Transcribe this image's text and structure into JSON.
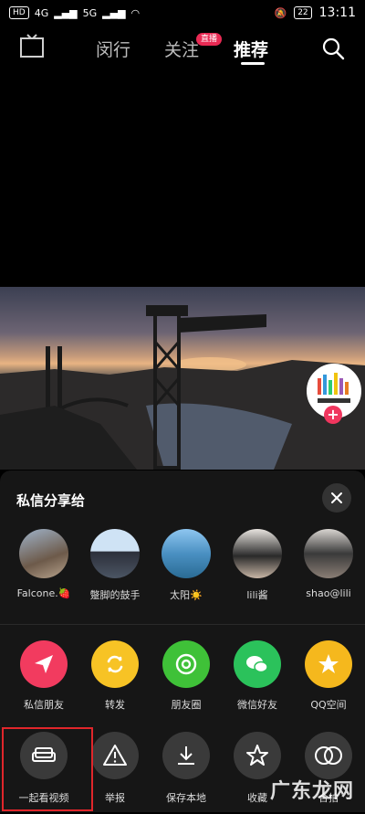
{
  "status_bar": {
    "left_badges": [
      "HD",
      "4G",
      "5G"
    ],
    "battery": "22",
    "time": "13:11"
  },
  "top_nav": {
    "live_icon_label": "直播",
    "tabs": [
      {
        "label": "闵行"
      },
      {
        "label": "关注"
      },
      {
        "label": "推荐"
      }
    ],
    "live_badge": "直播"
  },
  "share_sheet": {
    "title": "私信分享给",
    "friends": [
      {
        "name": "Falcone.🍓"
      },
      {
        "name": "蹩脚的鼓手"
      },
      {
        "name": "太阳☀️"
      },
      {
        "name": "lili酱"
      },
      {
        "name": "shao@lili"
      }
    ],
    "apps": [
      {
        "label": "私信朋友",
        "color": "#f23b5f"
      },
      {
        "label": "转发",
        "color": "#f7c325"
      },
      {
        "label": "朋友圈",
        "color": "#3fc138"
      },
      {
        "label": "微信好友",
        "color": "#2bc25b"
      },
      {
        "label": "QQ空间",
        "color": "#f5b81d"
      }
    ],
    "actions": [
      {
        "label": "一起看视频",
        "icon": "sofa-icon"
      },
      {
        "label": "举报",
        "icon": "warning-icon"
      },
      {
        "label": "保存本地",
        "icon": "download-icon"
      },
      {
        "label": "收藏",
        "icon": "star-icon"
      },
      {
        "label": "合拍",
        "icon": "duet-icon"
      }
    ]
  },
  "watermark": "广东龙网",
  "highlight_color": "#e0262b"
}
